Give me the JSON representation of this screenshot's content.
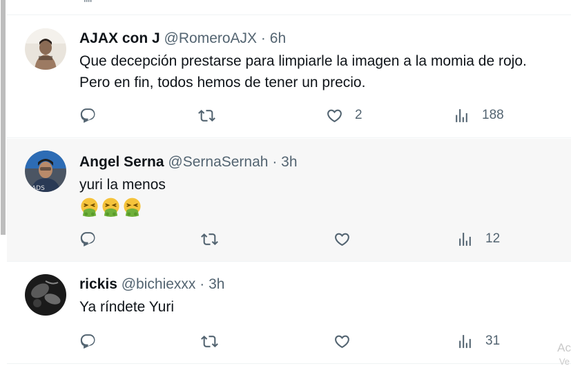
{
  "tweets": [
    {
      "name": "AJAX con J",
      "handle": "@RomeroAJX",
      "separator": "·",
      "time": "6h",
      "text_lines": [
        "Que decepción prestarse para limpiarle la imagen a la momia de rojo.",
        "Pero en fin, todos hemos de tener un precio."
      ],
      "replies": "",
      "retweets": "",
      "likes": "2",
      "views": "188",
      "icons": [
        "reply-icon",
        "retweet-icon",
        "heart-icon",
        "views-icon"
      ]
    },
    {
      "name": "Angel Serna",
      "handle": "@SernaSernah",
      "separator": "·",
      "time": "3h",
      "text_lines": [
        "yuri la menos"
      ],
      "emojis": [
        "vomiting-face-emoji",
        "vomiting-face-emoji",
        "vomiting-face-emoji"
      ],
      "replies": "",
      "retweets": "",
      "likes": "",
      "views": "12",
      "icons": [
        "reply-icon",
        "retweet-icon",
        "heart-icon",
        "views-icon"
      ]
    },
    {
      "name": "rickis",
      "handle": "@bichiexxx",
      "separator": "·",
      "time": "3h",
      "text_lines": [
        "Ya ríndete Yuri"
      ],
      "replies": "",
      "retweets": "",
      "likes": "",
      "views": "31",
      "icons": [
        "reply-icon",
        "retweet-icon",
        "heart-icon",
        "views-icon"
      ]
    }
  ],
  "overlay": {
    "line1": "Ac",
    "line2": "Ve"
  },
  "colors": {
    "text": "#0f1419",
    "secondary": "#536471",
    "hover_bg": "#f7f7f7",
    "divider": "#eff3f4"
  }
}
